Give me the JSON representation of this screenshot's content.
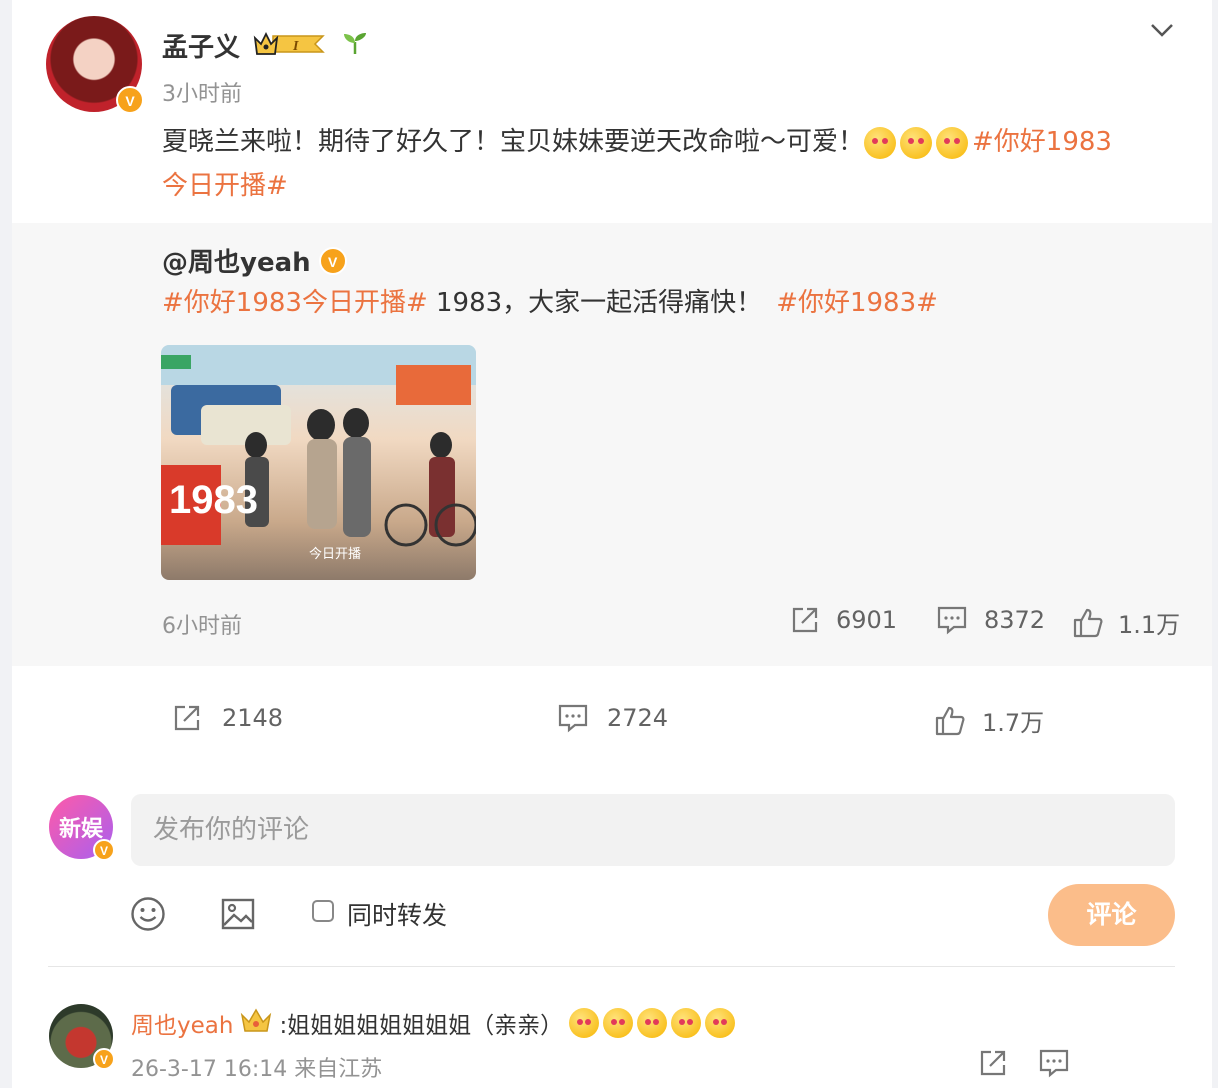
{
  "post": {
    "author": "孟子义",
    "time": "3小时前",
    "text": "夏晓兰来啦！期待了好久了！宝贝妹妹要逆天改命啦～可爱！",
    "topic_line1": "#你好1983",
    "topic_line2": "今日开播#",
    "verified_badge": "V",
    "level_badge": "I"
  },
  "retweet": {
    "author": "@周也yeah",
    "topic1": "#你好1983今日开播#",
    "text": " 1983，大家一起活得痛快！",
    "topic2": "#你好1983#",
    "image_caption": "今日开播",
    "image_title": "1983",
    "time": "6小时前",
    "repost_count": "6901",
    "comment_count": "8372",
    "like_count": "1.1万"
  },
  "actions": {
    "repost_count": "2148",
    "comment_count": "2724",
    "like_count": "1.7万"
  },
  "composer": {
    "avatar_text": "新娱",
    "placeholder": "发布你的评论",
    "also_repost_label": "同时转发",
    "submit_label": "评论"
  },
  "comments": [
    {
      "author": "周也yeah",
      "text": ":姐姐姐姐姐姐姐姐（亲亲）",
      "meta": "26-3-17 16:14 来自江苏"
    }
  ],
  "colors": {
    "topic": "#eb7340",
    "verified": "#f7a21b",
    "submit_button": "#fbbd8a",
    "retweet_bg": "#f7f7f7"
  },
  "icons": [
    "chevron-down-icon",
    "crown-level-icon",
    "sprout-icon",
    "repost-icon",
    "comment-icon",
    "like-icon",
    "emoji-icon",
    "image-icon"
  ]
}
